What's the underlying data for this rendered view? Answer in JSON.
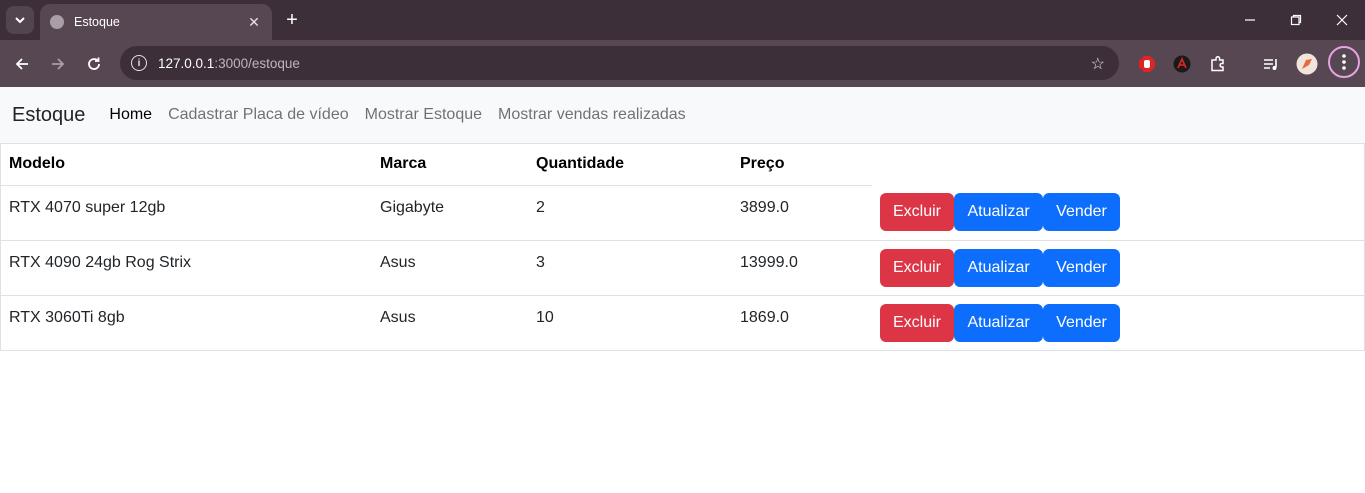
{
  "browser": {
    "tab_title": "Estoque",
    "url_host": "127.0.0.1",
    "url_path": ":3000/estoque"
  },
  "navbar": {
    "brand": "Estoque",
    "links": [
      "Home",
      "Cadastrar Placa de vídeo",
      "Mostrar Estoque",
      "Mostrar vendas realizadas"
    ]
  },
  "table": {
    "headers": [
      "Modelo",
      "Marca",
      "Quantidade",
      "Preço"
    ],
    "rows": [
      [
        "RTX 4070 super 12gb",
        "Gigabyte",
        "2",
        "3899.0"
      ],
      [
        "RTX 4090 24gb Rog Strix",
        "Asus",
        "3",
        "13999.0"
      ],
      [
        "RTX 3060Ti 8gb",
        "Asus",
        "10",
        "1869.0"
      ]
    ],
    "actions": {
      "delete": "Excluir",
      "update": "Atualizar",
      "sell": "Vender"
    }
  },
  "colors": {
    "danger": "#dc3545",
    "primary": "#0d6efd"
  }
}
